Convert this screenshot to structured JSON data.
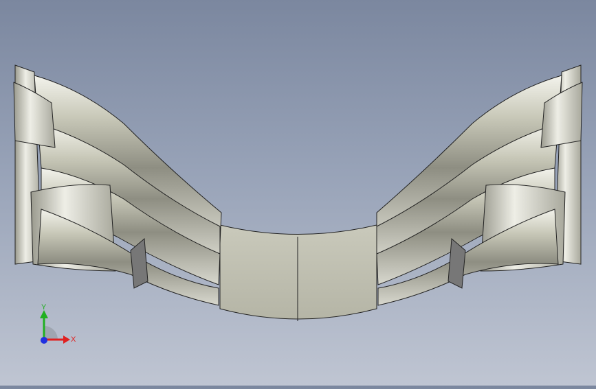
{
  "viewport": {
    "model": "front-wing-assembly"
  },
  "triad": {
    "x_label": "X",
    "y_label": "Y",
    "x_color": "#e02020",
    "y_color": "#20b020",
    "z_color": "#2030e0"
  }
}
